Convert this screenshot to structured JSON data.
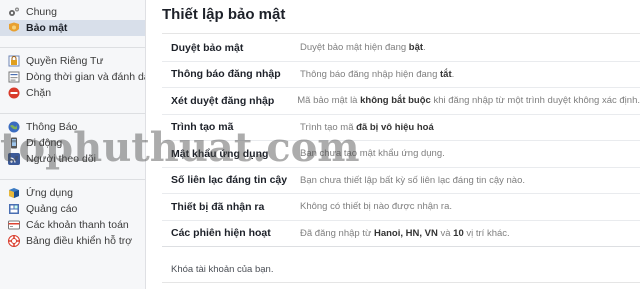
{
  "sidebar": {
    "groups": [
      [
        {
          "label": "Chung",
          "icon": "gear-icon",
          "active": false
        },
        {
          "label": "Bảo mật",
          "icon": "shield-badge-icon",
          "active": true
        }
      ],
      [
        {
          "label": "Quyền Riêng Tư",
          "icon": "lock-icon",
          "active": false
        },
        {
          "label": "Dòng thời gian và đánh dấu",
          "icon": "timeline-icon",
          "active": false
        },
        {
          "label": "Chặn",
          "icon": "block-icon",
          "active": false
        }
      ],
      [
        {
          "label": "Thông Báo",
          "icon": "globe-icon",
          "active": false
        },
        {
          "label": "Di động",
          "icon": "mobile-icon",
          "active": false
        },
        {
          "label": "Người theo dõi",
          "icon": "rss-icon",
          "active": false
        }
      ],
      [
        {
          "label": "Ứng dụng",
          "icon": "apps-icon",
          "active": false
        },
        {
          "label": "Quảng cáo",
          "icon": "ads-icon",
          "active": false
        },
        {
          "label": "Các khoản thanh toán",
          "icon": "payment-icon",
          "active": false
        },
        {
          "label": "Bảng điều khiển hỗ trợ",
          "icon": "support-icon",
          "active": false
        }
      ]
    ]
  },
  "main": {
    "title": "Thiết lập bảo mật",
    "rows": [
      {
        "label": "Duyệt bảo mật",
        "value": [
          {
            "t": "Duyệt bảo mật hiện đang "
          },
          {
            "t": "bật",
            "b": true
          },
          {
            "t": "."
          }
        ]
      },
      {
        "label": "Thông báo đăng nhập",
        "value": [
          {
            "t": "Thông báo đăng nhập hiện đang "
          },
          {
            "t": "tắt",
            "b": true
          },
          {
            "t": "."
          }
        ]
      },
      {
        "label": "Xét duyệt đăng nhập",
        "value": [
          {
            "t": "Mã bảo mật là "
          },
          {
            "t": "không bắt buộc",
            "b": true
          },
          {
            "t": " khi đăng nhập từ một trình duyệt không xác định."
          }
        ]
      },
      {
        "label": "Trình tạo mã",
        "value": [
          {
            "t": "Trình tạo mã "
          },
          {
            "t": "đã bị vô hiệu hoá",
            "b": true
          }
        ]
      },
      {
        "label": "Mật khẩu ứng dụng",
        "value": [
          {
            "t": "Bạn chưa tạo mật khẩu ứng dụng."
          }
        ]
      },
      {
        "label": "Số liên lạc đáng tin cậy",
        "value": [
          {
            "t": "Bạn chưa thiết lập bất kỳ số liên lạc đáng tin cậy nào."
          }
        ]
      },
      {
        "label": "Thiết bị đã nhận ra",
        "value": [
          {
            "t": "Không có thiết bị nào được nhận ra."
          }
        ]
      },
      {
        "label": "Các phiên hiện hoạt",
        "value": [
          {
            "t": "Đã đăng nhập từ "
          },
          {
            "t": "Hanoi, HN, VN",
            "b": true
          },
          {
            "t": " và "
          },
          {
            "t": "10",
            "b": true
          },
          {
            "t": " vị trí khác."
          }
        ]
      }
    ],
    "deactivate_link": "Khóa tài khoản của bạn."
  },
  "watermark": "tophuthuat.com",
  "colors": {
    "sidebar_bg": "#f6f7f9",
    "active_bg": "#d8dfea",
    "label": "#1d2129",
    "value": "#7f7f7f"
  }
}
